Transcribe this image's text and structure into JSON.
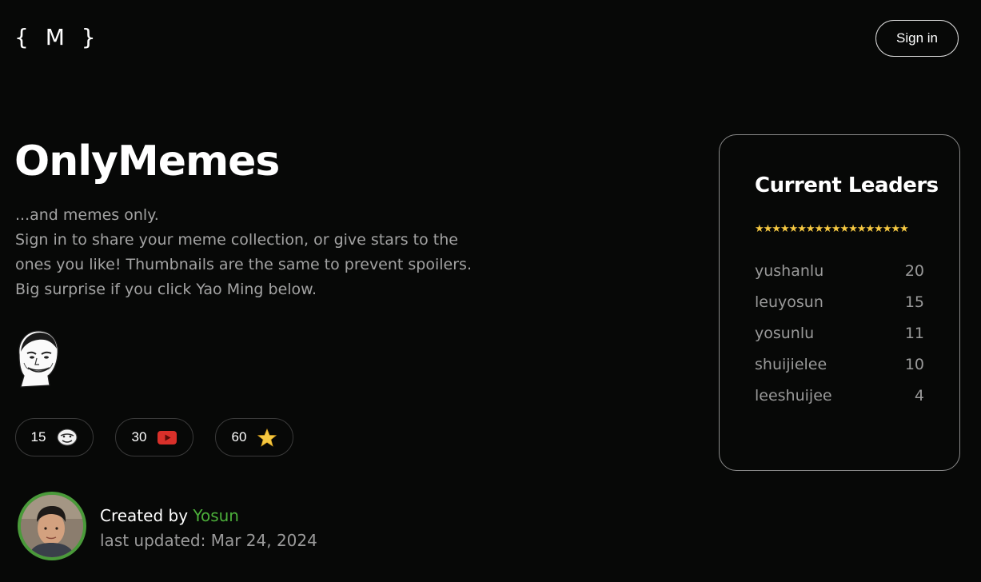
{
  "header": {
    "logo_text": "{ M }",
    "signin_label": "Sign in"
  },
  "hero": {
    "title": "OnlyMemes",
    "tagline": "...and memes only.",
    "description": "Sign in to share your meme collection, or give stars to the ones you like! Thumbnails are the same to prevent spoilers. Big surprise if you click Yao Ming below."
  },
  "stats": [
    {
      "value": "15",
      "icon": "meme-face-icon"
    },
    {
      "value": "30",
      "icon": "youtube-icon"
    },
    {
      "value": "60",
      "icon": "star-icon"
    }
  ],
  "credits": {
    "created_by_label": "Created by",
    "author": "Yosun",
    "last_updated": "last updated: Mar 24, 2024"
  },
  "leaderboard": {
    "title": "Current Leaders",
    "stars": "★★★★★★★★★★★★★★★★★★",
    "entries": [
      {
        "name": "yushanlu",
        "score": "20"
      },
      {
        "name": "leuyosun",
        "score": "15"
      },
      {
        "name": "yosunlu",
        "score": "11"
      },
      {
        "name": "shuijielee",
        "score": "10"
      },
      {
        "name": "leeshuijee",
        "score": "4"
      }
    ]
  },
  "colors": {
    "background": "#070807",
    "accent_green": "#4caf3a",
    "star_yellow": "#f5c842",
    "youtube_red": "#d9302a"
  }
}
